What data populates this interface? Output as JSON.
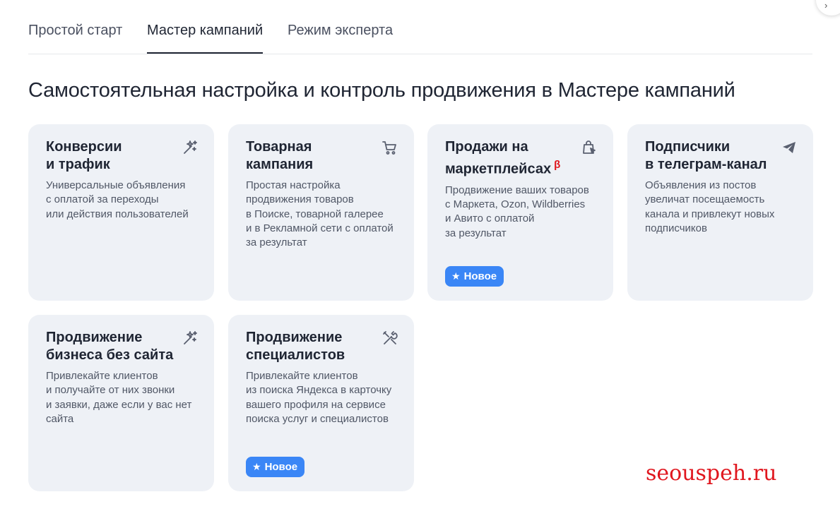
{
  "tabs": [
    {
      "label": "Простой старт",
      "active": false
    },
    {
      "label": "Мастер кампаний",
      "active": true
    },
    {
      "label": "Режим эксперта",
      "active": false
    }
  ],
  "page_title": "Самостоятельная настройка и контроль продвижения в Мастере кампаний",
  "cards": [
    {
      "title_lines": [
        "Конверсии",
        "и трафик"
      ],
      "desc_lines": [
        "Универсальные объявления",
        "с оплатой за переходы",
        "или действия пользователей"
      ],
      "icon": "magic-wand-icon"
    },
    {
      "title_lines": [
        "Товарная",
        "кампания"
      ],
      "desc_lines": [
        "Простая настройка",
        "продвижения товаров",
        "в Поиске, товарной галерее",
        "и в Рекламной сети с оплатой",
        "за результат"
      ],
      "icon": "cart-icon"
    },
    {
      "title_lines": [
        "Продажи на",
        "маркетплейсах"
      ],
      "beta": "β",
      "desc_lines": [
        "Продвижение ваших товаров",
        "с Маркета, Ozon, Wildberries",
        "и Авито с оплатой",
        "за результат"
      ],
      "icon": "shopping-bag-icon",
      "badge": "Новое"
    },
    {
      "title_lines": [
        "Подписчики",
        "в телеграм-канал"
      ],
      "desc_lines": [
        "Объявления из постов",
        "увеличат посещаемость",
        "канала и привлекут новых",
        "подписчиков"
      ],
      "icon": "telegram-icon"
    },
    {
      "title_lines": [
        "Продвижение",
        "бизнеса без сайта"
      ],
      "desc_lines": [
        "Привлекайте клиентов",
        "и получайте от них звонки",
        "и заявки, даже если у вас нет",
        "сайта"
      ],
      "icon": "magic-wand-icon"
    },
    {
      "title_lines": [
        "Продвижение",
        "специалистов"
      ],
      "desc_lines": [
        "Привлекайте клиентов",
        "из поиска Яндекса в карточку",
        "вашего профиля на сервисе",
        "поиска услуг и специалистов"
      ],
      "icon": "tools-icon",
      "badge": "Новое"
    }
  ],
  "watermark": "seouspeh.ru",
  "colors": {
    "accent": "#3a86f6",
    "card_bg": "#eef1f6",
    "beta": "#e0161e"
  }
}
